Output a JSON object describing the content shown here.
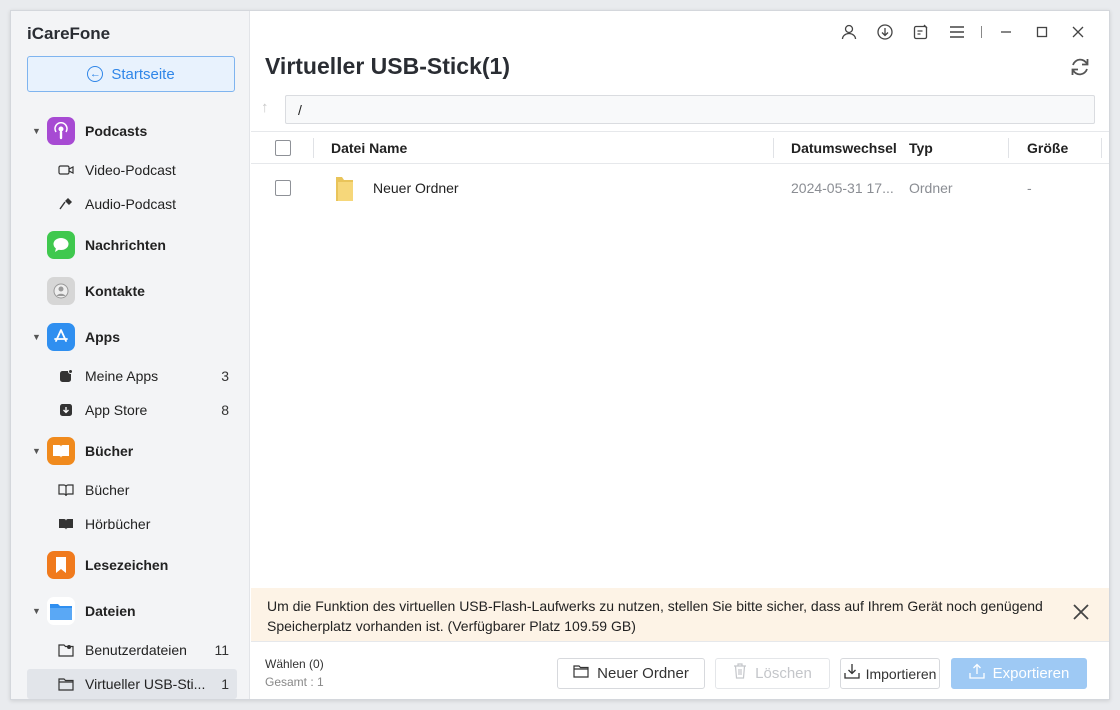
{
  "app": {
    "title": "iCareFone"
  },
  "sidebar": {
    "home_label": "Startseite",
    "categories": [
      {
        "label": "Podcasts",
        "color": "#a74ad3",
        "icon": "podcast-icon",
        "subs": [
          {
            "label": "Video-Podcast",
            "icon": "video-camera-icon",
            "count": ""
          },
          {
            "label": "Audio-Podcast",
            "icon": "microphone-icon",
            "count": ""
          }
        ]
      },
      {
        "label": "Nachrichten",
        "color": "#3fc84e",
        "icon": "message-bubble-icon",
        "subs": []
      },
      {
        "label": "Kontakte",
        "color": "#bfbfbf",
        "icon": "contact-icon",
        "subs": []
      },
      {
        "label": "Apps",
        "color": "#2f8ff0",
        "icon": "app-store-icon",
        "subs": [
          {
            "label": "Meine Apps",
            "icon": "my-apps-icon",
            "count": "3"
          },
          {
            "label": "App Store",
            "icon": "download-box-icon",
            "count": "8"
          }
        ]
      },
      {
        "label": "Bücher",
        "color": "#f08a1d",
        "icon": "book-open-icon",
        "subs": [
          {
            "label": "Bücher",
            "icon": "book-outline-icon",
            "count": ""
          },
          {
            "label": "Hörbücher",
            "icon": "audiobook-icon",
            "count": ""
          }
        ]
      },
      {
        "label": "Lesezeichen",
        "color": "#f07a1d",
        "icon": "bookmark-icon",
        "subs": []
      },
      {
        "label": "Dateien",
        "color": "#2f8ff0",
        "icon": "folder-icon",
        "subs": [
          {
            "label": "Benutzerdateien",
            "icon": "user-folder-icon",
            "count": "11"
          },
          {
            "label": "Virtueller USB-Sti...",
            "icon": "folder-outline-icon",
            "count": "1"
          }
        ]
      }
    ]
  },
  "main": {
    "title": "Virtueller USB-Stick(1)",
    "path": "/",
    "columns": {
      "name": "Datei Name",
      "date": "Datumswechsel",
      "type": "Typ",
      "size": "Größe"
    },
    "rows": [
      {
        "name": "Neuer Ordner",
        "date": "2024-05-31 17...",
        "type": "Ordner",
        "size": "-"
      }
    ],
    "notice": "Um die Funktion des virtuellen USB-Flash-Laufwerks zu nutzen, stellen Sie bitte sicher, dass auf Ihrem Gerät noch genügend Speicherplatz vorhanden ist. (Verfügbarer Platz 109.59 GB)",
    "footer": {
      "selected": "Wählen (0)",
      "total": "Gesamt : 1",
      "new_folder": "Neuer Ordner",
      "delete": "Löschen",
      "import": "Importieren",
      "export": "Exportieren"
    }
  },
  "colors": {
    "accent": "#2f86e8",
    "notice_bg": "#fdf3e6",
    "sidebar_bg": "#f3f4f6"
  }
}
